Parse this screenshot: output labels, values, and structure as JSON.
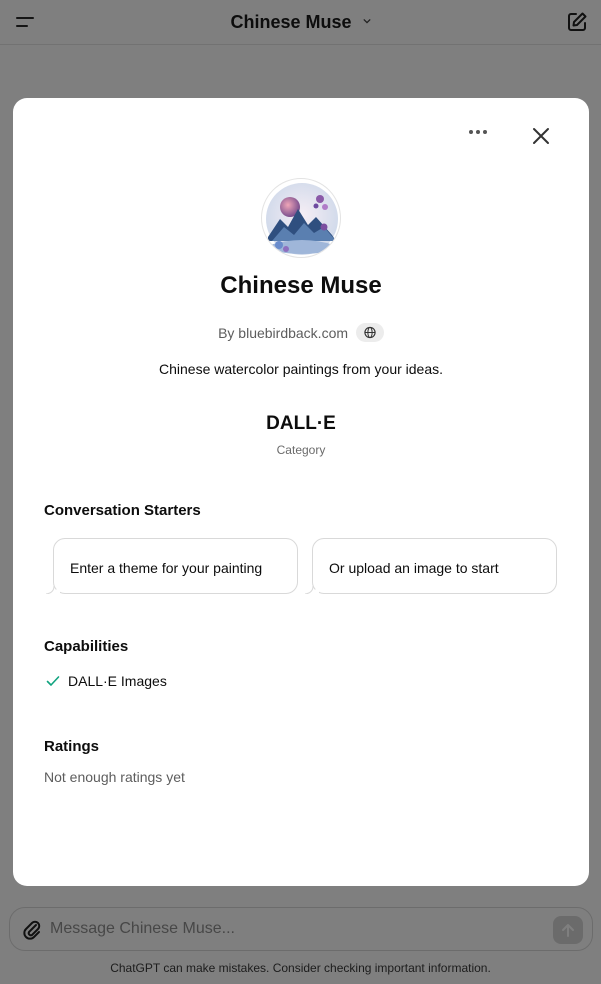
{
  "topbar": {
    "title": "Chinese Muse"
  },
  "composer": {
    "placeholder": "Message Chinese Muse..."
  },
  "disclaimer": "ChatGPT can make mistakes. Consider checking important information.",
  "modal": {
    "name": "Chinese Muse",
    "byline_prefix": "By ",
    "author": "bluebirdback.com",
    "description": "Chinese watercolor paintings from your ideas.",
    "category_value": "DALL·E",
    "category_label": "Category",
    "starters_title": "Conversation Starters",
    "starters": [
      "Enter a theme for your painting",
      "Or upload an image to start"
    ],
    "capabilities_title": "Capabilities",
    "capabilities": [
      "DALL·E Images"
    ],
    "ratings_title": "Ratings",
    "ratings_text": "Not enough ratings yet"
  },
  "colors": {
    "overlay": "rgba(0,0,0,0.5)",
    "check": "#10a37f",
    "send_disabled": "#d7d7d7"
  },
  "icons": [
    "menu-icon",
    "chevron-down-icon",
    "compose-icon",
    "more-icon",
    "close-icon",
    "globe-icon",
    "check-icon",
    "paperclip-icon",
    "arrow-up-icon"
  ]
}
